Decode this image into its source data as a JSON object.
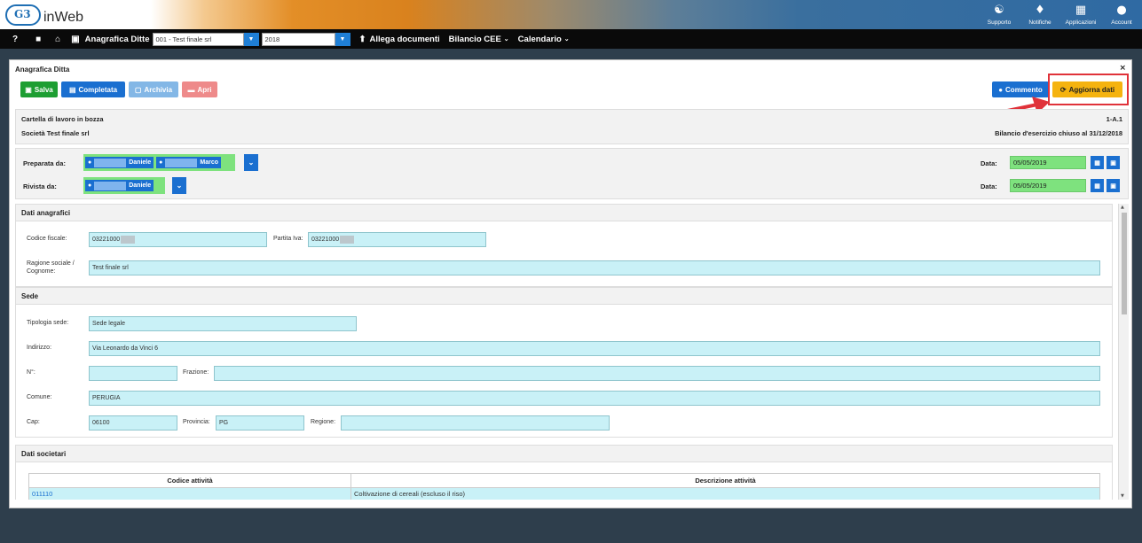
{
  "app": {
    "brand": "inWeb",
    "logo_text": "G3"
  },
  "top_actions": [
    {
      "label": "Supporto",
      "icon": "headset-icon",
      "glyph": "🎧"
    },
    {
      "label": "Notifiche",
      "icon": "bell-icon",
      "glyph": "🔔"
    },
    {
      "label": "Applicazioni",
      "icon": "grid-icon",
      "glyph": "▦"
    },
    {
      "label": "Account",
      "icon": "user-circle-icon",
      "glyph": "●"
    }
  ],
  "navbar": {
    "help": "?",
    "anagrafica_label": "Anagrafica Ditte",
    "ditta_select": "001 - Test finale srl",
    "year_select": "2018",
    "allega_label": "Allega documenti",
    "bilancio_label": "Bilancio CEE",
    "calendario_label": "Calendario"
  },
  "panel": {
    "title": "Anagrafica Ditta",
    "close": "×",
    "buttons": {
      "salva": "Salva",
      "completata": "Completata",
      "archivia": "Archivia",
      "apri": "Apri",
      "commento": "Commento",
      "aggiorna": "Aggiorna dati"
    },
    "info": {
      "status": "Cartella di lavoro in bozza",
      "company": "Società Test finale srl",
      "code": "1-A.1",
      "bilancio": "Bilancio d'esercizio chiuso al 31/12/2018"
    },
    "preparata": {
      "label": "Preparata da:",
      "users": [
        "Daniele",
        "Marco"
      ],
      "date_label": "Data:",
      "date": "05/05/2019"
    },
    "rivista": {
      "label": "Rivista da:",
      "users": [
        "Daniele"
      ],
      "date_label": "Data:",
      "date": "05/05/2019"
    }
  },
  "dati_anagrafici": {
    "title": "Dati anagrafici",
    "codice_fiscale_label": "Codice fiscale:",
    "codice_fiscale": "03221000",
    "partita_iva_label": "Partita Iva:",
    "partita_iva": "03221000",
    "ragione_sociale_label": "Ragione sociale /",
    "ragione_sociale_label2": "Cognome:",
    "ragione_sociale": "Test finale srl"
  },
  "sede": {
    "title": "Sede",
    "tipologia_label": "Tipologia sede:",
    "tipologia": "Sede legale",
    "indirizzo_label": "Indirizzo:",
    "indirizzo": "Via Leonardo da Vinci 6",
    "numero_label": "N°:",
    "numero": "",
    "frazione_label": "Frazione:",
    "frazione": "",
    "comune_label": "Comune:",
    "comune": "PERUGIA",
    "cap_label": "Cap:",
    "cap": "06100",
    "provincia_label": "Provincia:",
    "provincia": "PG",
    "regione_label": "Regione:",
    "regione": ""
  },
  "dati_societari": {
    "title": "Dati societari",
    "columns": [
      "Codice attività",
      "Descrizione attività"
    ],
    "rows": [
      {
        "codice": "011110",
        "descrizione": "Coltivazione di cereali (escluso il riso)"
      }
    ]
  }
}
